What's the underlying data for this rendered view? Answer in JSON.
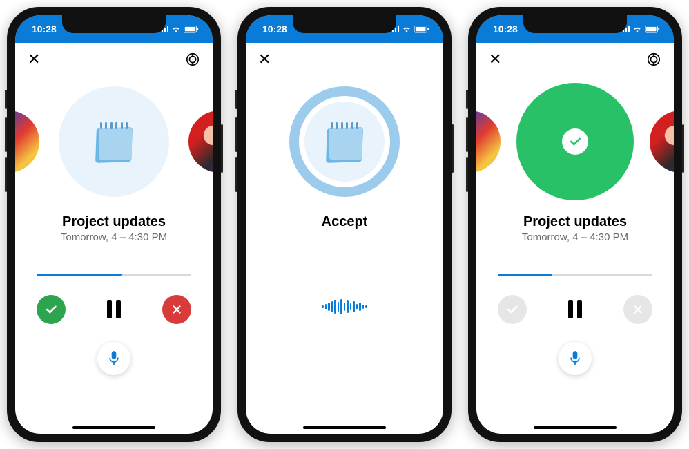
{
  "status": {
    "time": "10:28"
  },
  "phones": [
    {
      "title": "Project updates",
      "subtitle": "Tomorrow, 4 – 4:30 PM",
      "progress_pct": 55,
      "show_cast": true,
      "show_side_avatars": true,
      "hero": "notepad",
      "actions": {
        "accept_enabled": true,
        "reject_enabled": true
      },
      "bottom": "mic"
    },
    {
      "title": "Accept",
      "subtitle": "",
      "show_cast": false,
      "show_side_avatars": false,
      "hero": "notepad_ring",
      "bottom": "waveform"
    },
    {
      "title": "Project updates",
      "subtitle": "Tomorrow, 4 – 4:30 PM",
      "progress_pct": 35,
      "show_cast": true,
      "show_side_avatars": true,
      "hero": "green_check",
      "actions": {
        "accept_enabled": false,
        "reject_enabled": false
      },
      "bottom": "mic"
    }
  ],
  "colors": {
    "brand_blue": "#0a7cd8",
    "green": "#28c168",
    "red": "#d93a3a"
  }
}
